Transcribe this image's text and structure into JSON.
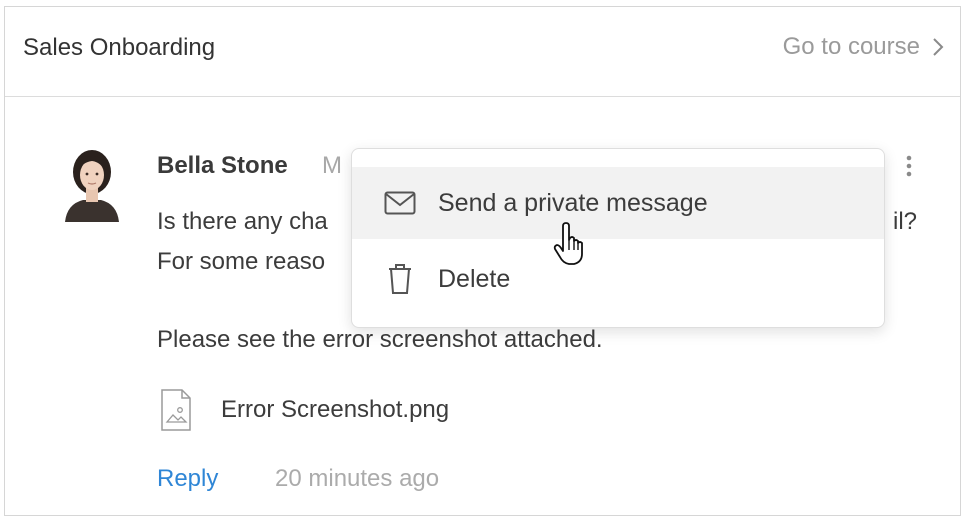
{
  "header": {
    "course_title": "Sales Onboarding",
    "go_to_course_label": "Go to course"
  },
  "comment": {
    "author": "Bella Stone",
    "meta_partial": "M",
    "body_line1_start": "Is there any cha",
    "body_line1_end": "il?",
    "body_line2_start": "For some reaso",
    "body_line3": "Please see the error screenshot attached.",
    "attachment_name": "Error Screenshot.png",
    "reply_label": "Reply",
    "time_ago": "20 minutes ago"
  },
  "context_menu": {
    "items": [
      {
        "label": "Send a private message",
        "icon": "envelope-icon",
        "hovered": true
      },
      {
        "label": "Delete",
        "icon": "trash-icon",
        "hovered": false
      }
    ]
  },
  "colors": {
    "link_blue": "#2f86d6",
    "muted_gray": "#9a9a9a",
    "text_dark": "#3c3c3c",
    "menu_hover_bg": "#f2f2f2"
  }
}
